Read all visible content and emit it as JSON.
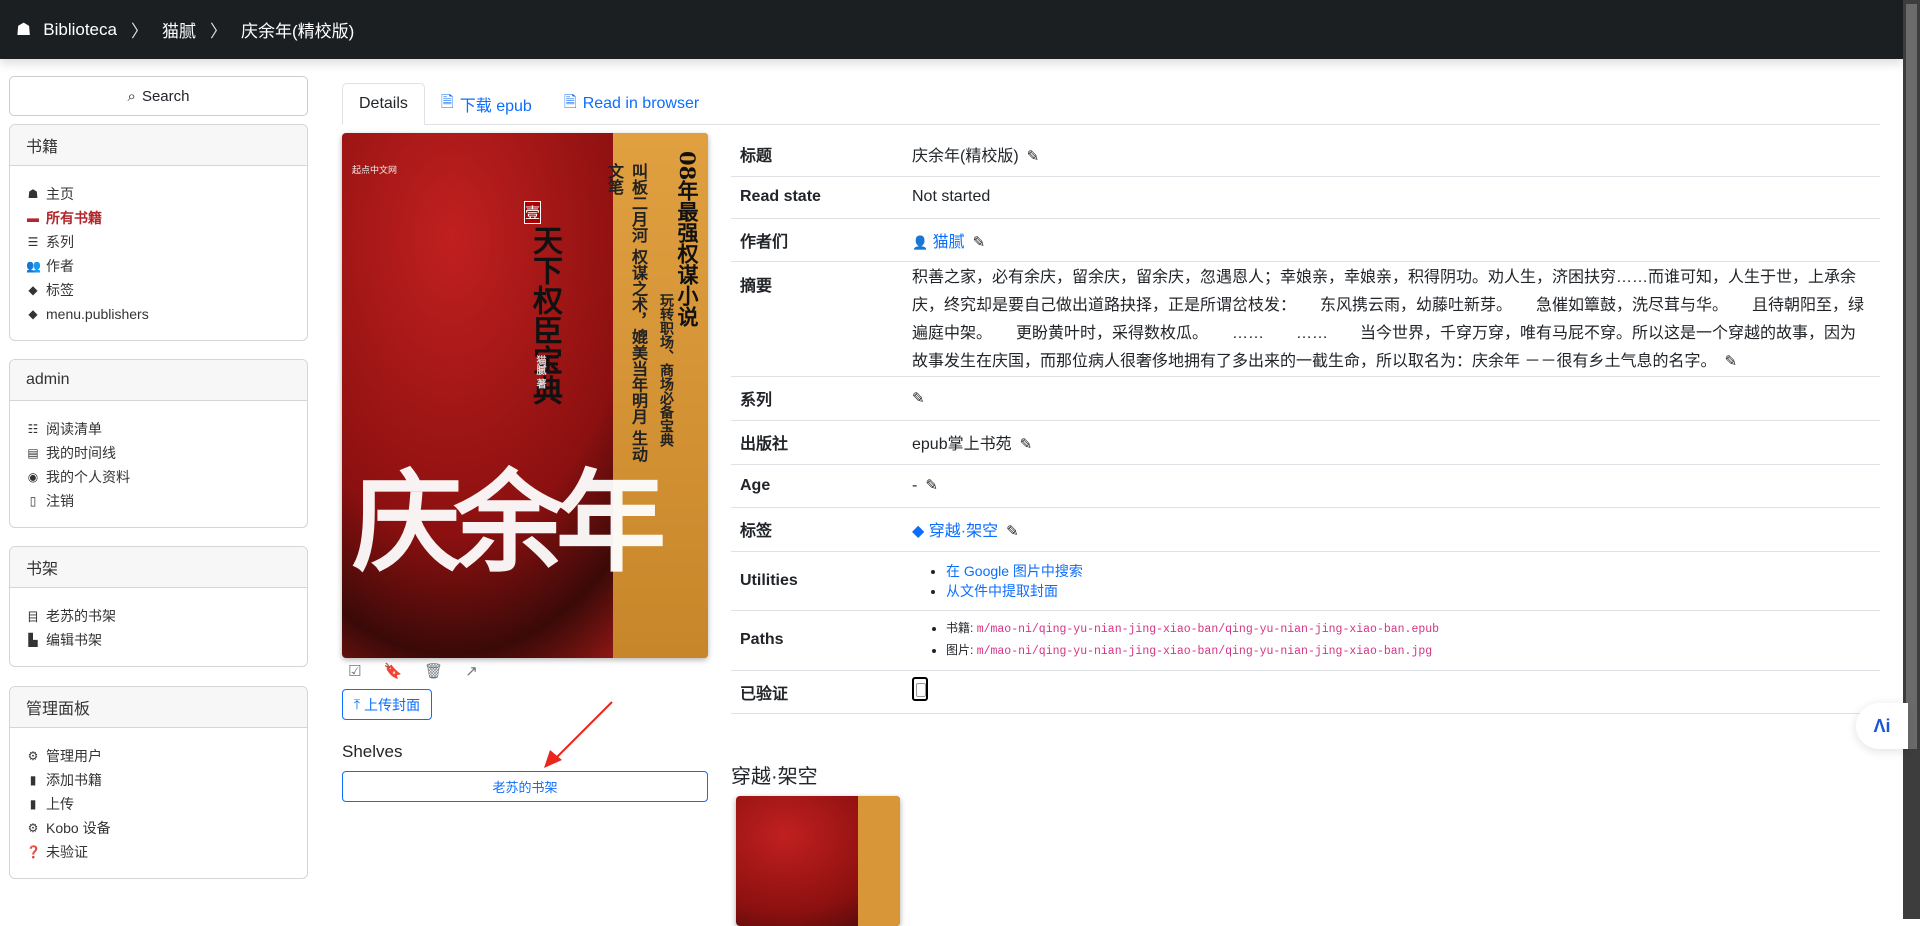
{
  "breadcrumb": {
    "home": "Biblioteca",
    "author": "猫腻",
    "title": "庆余年(精校版)"
  },
  "sidebar": {
    "search": "Search",
    "books": {
      "title": "书籍",
      "items": [
        {
          "label": "主页",
          "icon": "home-icon"
        },
        {
          "label": "所有书籍",
          "icon": "book-icon"
        },
        {
          "label": "系列",
          "icon": "list-icon"
        },
        {
          "label": "作者",
          "icon": "users-icon"
        },
        {
          "label": "标签",
          "icon": "tag-icon"
        },
        {
          "label": "menu.publishers",
          "icon": "tags-icon"
        }
      ]
    },
    "admin": {
      "title": "admin",
      "items": [
        {
          "label": "阅读清单"
        },
        {
          "label": "我的时间线"
        },
        {
          "label": "我的个人资料"
        },
        {
          "label": "注销"
        }
      ]
    },
    "shelves": {
      "title": "书架",
      "items": [
        {
          "label": "老苏的书架"
        },
        {
          "label": "编辑书架"
        }
      ]
    },
    "panel": {
      "title": "管理面板",
      "items": [
        {
          "label": "管理用户"
        },
        {
          "label": "添加书籍"
        },
        {
          "label": "上传"
        },
        {
          "label": "Kobo 设备"
        },
        {
          "label": "未验证"
        }
      ]
    }
  },
  "tabs": {
    "details": "Details",
    "download": "下载 epub",
    "read": "Read in browser"
  },
  "cover": {
    "publisher_text": "起点中文网",
    "headline": "08年最强权谋小说",
    "sub1": "玩转职场、商场必备宝典",
    "sub2": "叫板二月河 权谋之术，媲美当年明月 生动文笔",
    "title_text": "天下权臣宝典",
    "volume": "壹",
    "author_text": "猫腻 著",
    "big_title": "庆余年"
  },
  "upload_cover": "上传封面",
  "shelves_label": "Shelves",
  "shelf_button": "老苏的书架",
  "details": {
    "title_label": "标题",
    "title": "庆余年(精校版)",
    "read_state_label": "Read state",
    "read_state": "Not started",
    "authors_label": "作者们",
    "author": "猫腻",
    "summary_label": "摘要",
    "summary": "积善之家，必有余庆，留余庆，留余庆，忽遇恩人；幸娘亲，幸娘亲，积得阴功。劝人生，济困扶穷……而谁可知，人生于世，上承余庆，终究却是要自己做出道路抉择，正是所谓岔枝发：　　东风携云雨，幼藤吐新芽。　　急催如簟鼓，洗尽茸与华。　　且待朝阳至，绿遍庭中架。　　更盼黄叶时，采得数枚瓜。　　……　　……　　当今世界，千穿万穿，唯有马屁不穿。所以这是一个穿越的故事，因为故事发生在庆国，而那位病人很奢侈地拥有了多出来的一截生命，所以取名为：庆余年 －－很有乡土气息的名字。",
    "series_label": "系列",
    "publisher_label": "出版社",
    "publisher": "epub掌上书苑",
    "age_label": "Age",
    "age": "-",
    "tags_label": "标签",
    "tag": "穿越·架空",
    "utilities_label": "Utilities",
    "util1": "在 Google 图片中搜索",
    "util2": "从文件中提取封面",
    "paths_label": "Paths",
    "book_path_label": "书籍:",
    "book_path": "m/mao-ni/qing-yu-nian-jing-xiao-ban/qing-yu-nian-jing-xiao-ban.epub",
    "img_path_label": "图片:",
    "img_path": "m/mao-ni/qing-yu-nian-jing-xiao-ban/qing-yu-nian-jing-xiao-ban.jpg",
    "verified_label": "已验证",
    "verified": false
  },
  "related_tag_title": "穿越·架空",
  "colors": {
    "accent": "#0d6efd",
    "active": "#b3262b",
    "header": "#1c1f22"
  }
}
